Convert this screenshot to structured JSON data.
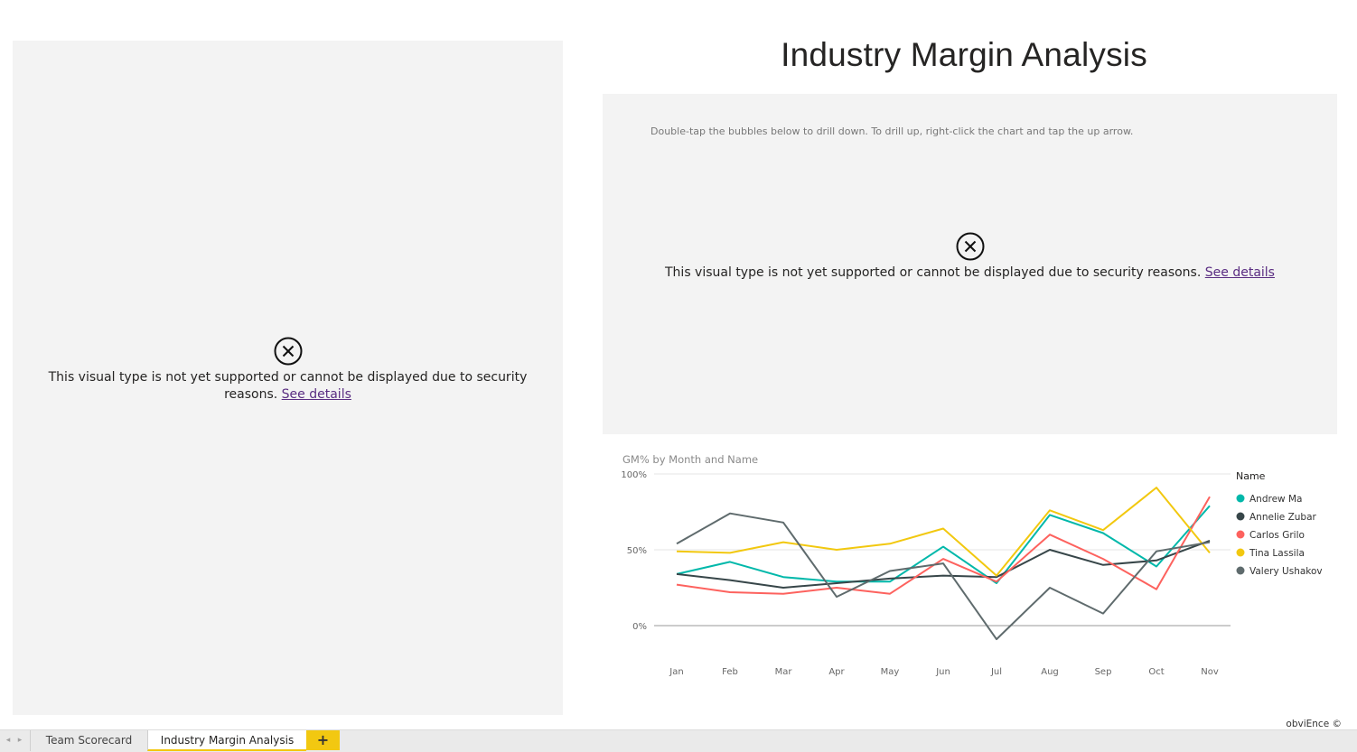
{
  "page": {
    "title": "Industry Margin Analysis",
    "instruction": "Double-tap the bubbles below to drill down. To drill up, right-click the chart and tap the up arrow.",
    "watermark": "obviEnce ©"
  },
  "left_visual": {
    "message": "This visual type is not yet supported or cannot be displayed due to security reasons.",
    "link": "See details",
    "icon": "close-circle-icon"
  },
  "right_visual": {
    "message": "This visual type is not yet supported or cannot be displayed due to security reasons.",
    "link": "See details",
    "icon": "close-circle-icon"
  },
  "tabs": {
    "items": [
      {
        "label": "Team Scorecard",
        "active": false
      },
      {
        "label": "Industry Margin Analysis",
        "active": true
      }
    ],
    "add_label": "+",
    "prev_icon": "chevron-left-icon",
    "next_icon": "chevron-right-icon",
    "accent": "#f2c811"
  },
  "chart_data": {
    "type": "line",
    "title": "GM% by Month and Name",
    "xlabel": "",
    "ylabel": "",
    "categories": [
      "Jan",
      "Feb",
      "Mar",
      "Apr",
      "May",
      "Jun",
      "Jul",
      "Aug",
      "Sep",
      "Oct",
      "Nov"
    ],
    "y_ticks": [
      "100%",
      "50%",
      "0%"
    ],
    "ylim": [
      0,
      100
    ],
    "grid": true,
    "legend_title": "Name",
    "legend_position": "right",
    "series": [
      {
        "name": "Andrew Ma",
        "color": "#01b8aa",
        "values": [
          34,
          42,
          32,
          29,
          29,
          52,
          28,
          73,
          61,
          39,
          79
        ]
      },
      {
        "name": "Annelie Zubar",
        "color": "#374649",
        "values": [
          34,
          30,
          25,
          28,
          31,
          33,
          32,
          50,
          40,
          43,
          56
        ]
      },
      {
        "name": "Carlos Grilo",
        "color": "#fd625e",
        "values": [
          27,
          22,
          21,
          25,
          21,
          44,
          29,
          60,
          44,
          24,
          85
        ]
      },
      {
        "name": "Tina Lassila",
        "color": "#f2c80f",
        "values": [
          49,
          48,
          55,
          50,
          54,
          64,
          33,
          76,
          63,
          91,
          48
        ]
      },
      {
        "name": "Valery Ushakov",
        "color": "#5f6b6d",
        "values": [
          54,
          74,
          68,
          19,
          36,
          41,
          -9,
          25,
          8,
          49,
          55
        ]
      }
    ]
  }
}
